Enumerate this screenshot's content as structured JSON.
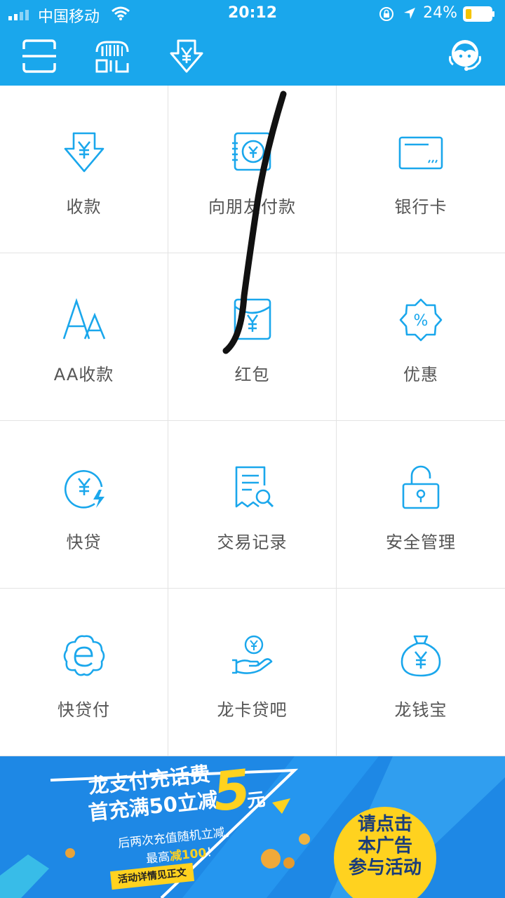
{
  "status_bar": {
    "carrier": "中国移动",
    "time": "20:12",
    "battery_pct": "24%",
    "battery_level": 0.24
  },
  "header": {
    "icons": [
      "scan-icon",
      "barcode-pay-icon",
      "receive-money-icon",
      "customer-service-icon"
    ]
  },
  "grid": [
    {
      "label": "收款",
      "icon": "receive-money-icon"
    },
    {
      "label": "向朋友付款",
      "icon": "pay-friend-icon"
    },
    {
      "label": "银行卡",
      "icon": "bank-card-icon"
    },
    {
      "label": "AA收款",
      "icon": "aa-collect-icon"
    },
    {
      "label": "红包",
      "icon": "red-packet-icon"
    },
    {
      "label": "优惠",
      "icon": "discount-icon"
    },
    {
      "label": "快贷",
      "icon": "quick-loan-icon"
    },
    {
      "label": "交易记录",
      "icon": "transaction-record-icon"
    },
    {
      "label": "安全管理",
      "icon": "security-lock-icon"
    },
    {
      "label": "快贷付",
      "icon": "quick-loan-pay-icon"
    },
    {
      "label": "龙卡贷吧",
      "icon": "card-loan-icon"
    },
    {
      "label": "龙钱宝",
      "icon": "money-bag-icon"
    }
  ],
  "banner": {
    "line1": "龙支付充话费",
    "line2": "首充满50立减",
    "big_number": "5",
    "unit": "元",
    "sub1": "后两次充值随机立减，",
    "sub2_prefix": "最高",
    "sub2_highlight": "减100",
    "sub2_suffix": "！",
    "ribbon": "活动详情见正文",
    "cta_line1": "请点击",
    "cta_line2": "本广告",
    "cta_line3": "参与活动",
    "colors": {
      "background": "#1e88e5",
      "accent": "#ffd21f"
    }
  },
  "colors": {
    "brand": "#1aa7ec",
    "icon": "#1aa7ec",
    "label": "#555555"
  }
}
